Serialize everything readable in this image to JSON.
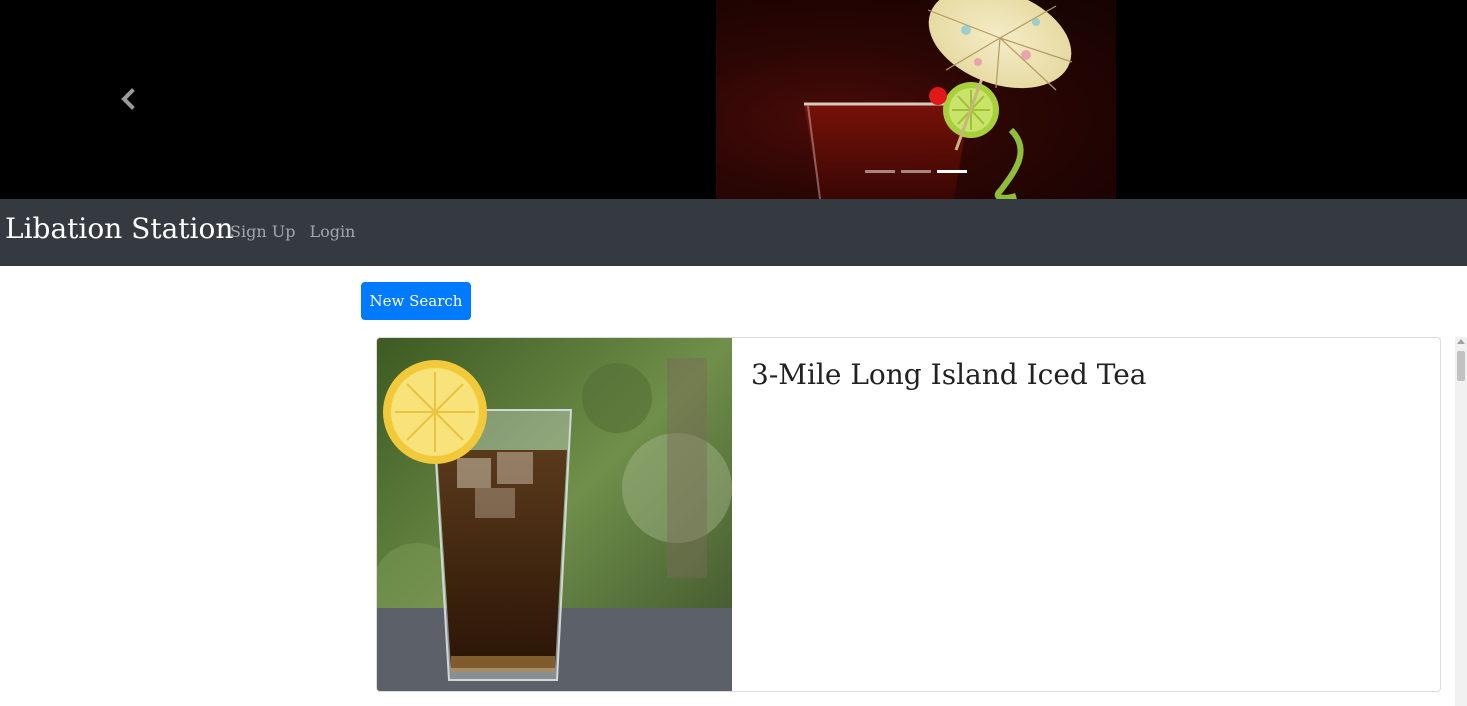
{
  "carousel": {
    "prev_icon": "chevron-left-icon",
    "indicators": [
      {
        "active": false
      },
      {
        "active": false
      },
      {
        "active": true
      }
    ]
  },
  "navbar": {
    "brand": "Libation Station",
    "links": [
      "Sign Up",
      "Login"
    ],
    "background": "#343a40"
  },
  "main": {
    "new_search_label": "New Search",
    "accent": "#007bff",
    "results": [
      {
        "title": "3-Mile Long Island Iced Tea"
      }
    ]
  }
}
